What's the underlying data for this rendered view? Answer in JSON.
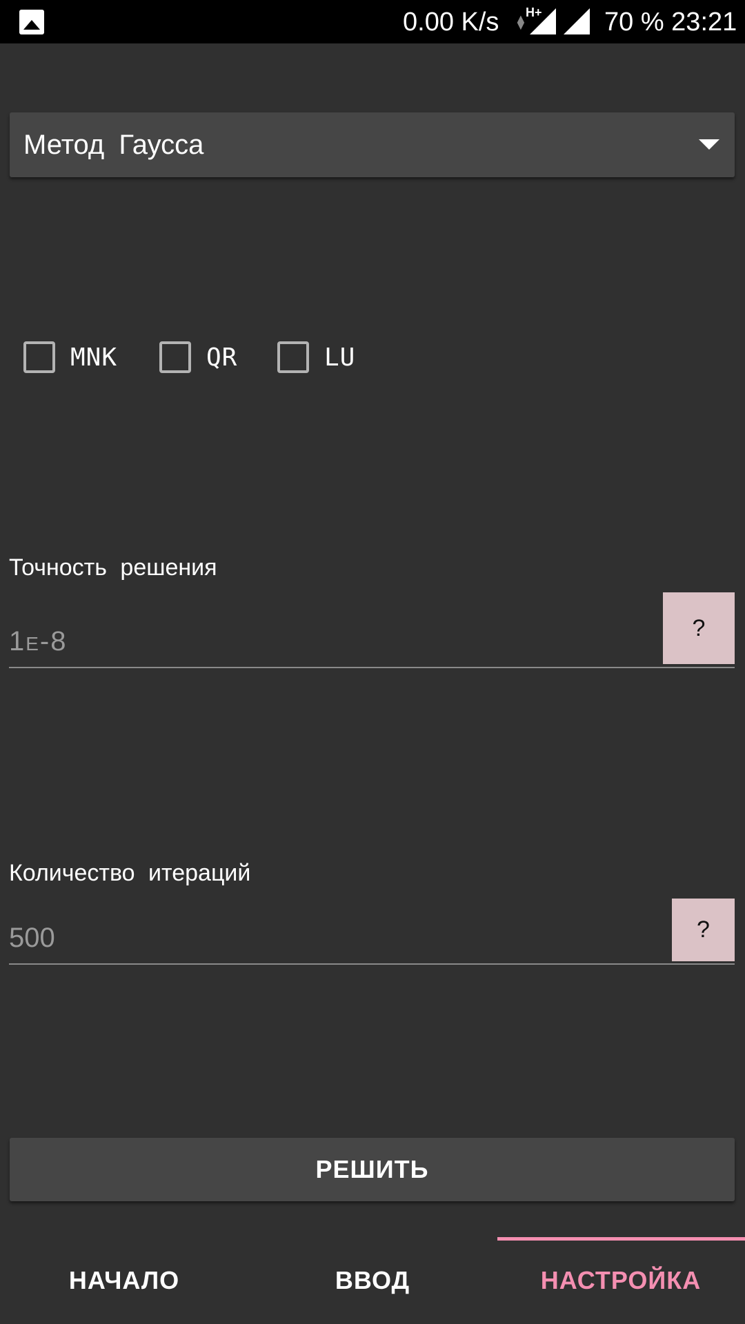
{
  "statusbar": {
    "speed": "0.00 K/s",
    "network_type": "H+",
    "battery_time": "70 % 23:21"
  },
  "method_spinner": {
    "selected": "Метод  Гаусса"
  },
  "checkboxes": [
    {
      "label": "MNK",
      "checked": false
    },
    {
      "label": "QR",
      "checked": false
    },
    {
      "label": "LU",
      "checked": false
    }
  ],
  "precision": {
    "label": "Точность  решения",
    "value": "1e-8",
    "help": "?"
  },
  "iterations": {
    "label": "Количество  итераций",
    "value": "500",
    "help": "?"
  },
  "solve_button": "РЕШИТЬ",
  "tabs": [
    {
      "label": "НАЧАЛО",
      "active": false
    },
    {
      "label": "ВВОД",
      "active": false
    },
    {
      "label": "НАСТРОЙКА",
      "active": true
    }
  ],
  "colors": {
    "background": "#303030",
    "surface": "#464646",
    "accent": "#f48fb1",
    "help_button": "#dbc2c6"
  }
}
